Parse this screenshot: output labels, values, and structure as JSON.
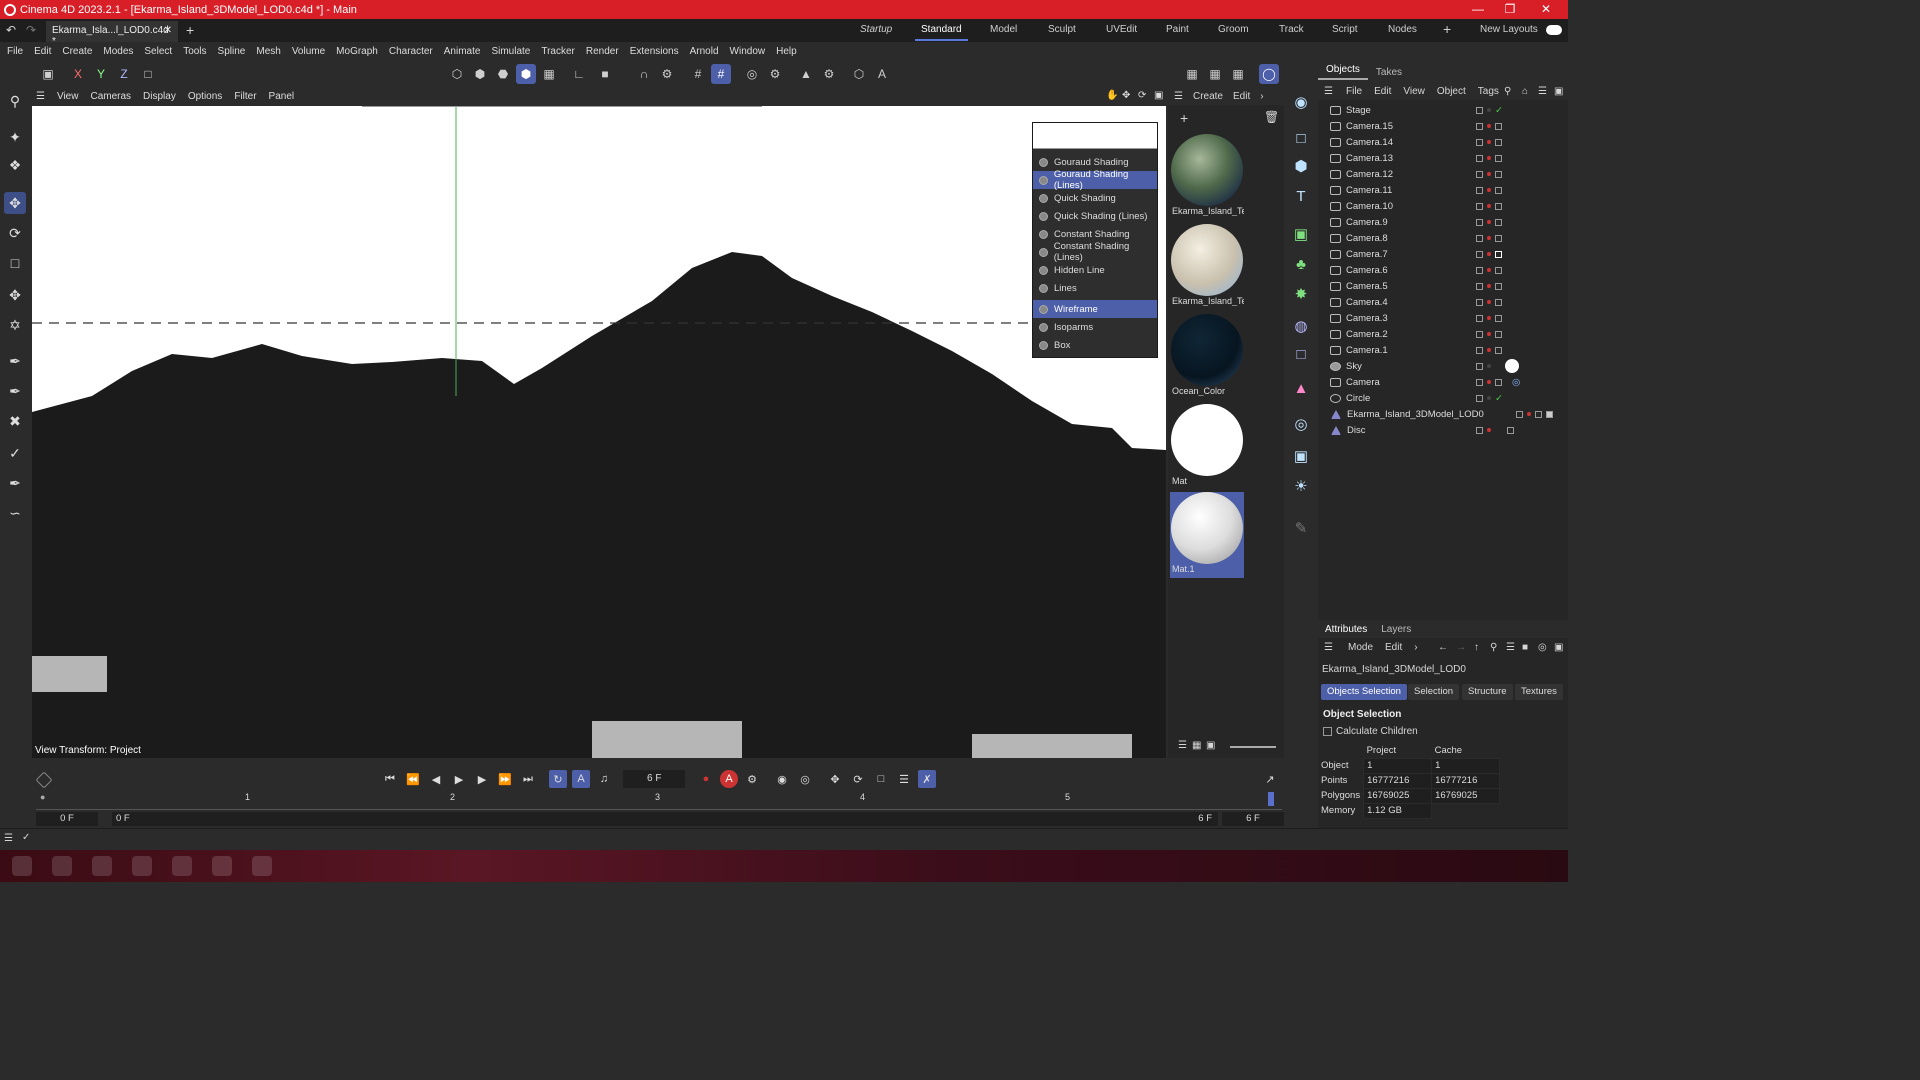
{
  "window": {
    "title": "Cinema 4D 2023.2.1 - [Ekarma_Island_3DModel_LOD0.c4d *] - Main"
  },
  "tabs": {
    "document": "Ekarma_Isla...l_LOD0.c4d *",
    "layouts": [
      "Startup",
      "Standard",
      "Model",
      "Sculpt",
      "UVEdit",
      "Paint",
      "Groom",
      "Track",
      "Script",
      "Nodes"
    ],
    "active_layout": "Standard",
    "new_layouts": "New Layouts"
  },
  "menu": [
    "File",
    "Edit",
    "Create",
    "Modes",
    "Select",
    "Tools",
    "Spline",
    "Mesh",
    "Volume",
    "MoGraph",
    "Character",
    "Animate",
    "Simulate",
    "Tracker",
    "Render",
    "Extensions",
    "Arnold",
    "Window",
    "Help"
  ],
  "axes": {
    "x": "X",
    "y": "Y",
    "z": "Z"
  },
  "viewport": {
    "menu": [
      "View",
      "Cameras",
      "Display",
      "Options",
      "Filter",
      "Panel"
    ],
    "view_transform": "View Transform: Project"
  },
  "shading_menu": {
    "items": [
      "Gouraud Shading",
      "Gouraud Shading (Lines)",
      "Quick Shading",
      "Quick Shading (Lines)",
      "Constant Shading",
      "Constant Shading (Lines)",
      "Hidden Line",
      "Lines",
      "Wireframe",
      "Isoparms",
      "Box"
    ],
    "selected": [
      "Gouraud Shading (Lines)",
      "Wireframe"
    ]
  },
  "materials": {
    "menu": [
      "Create",
      "Edit"
    ],
    "items": [
      "Ekarma_Island_Te",
      "Ekarma_Island_Te",
      "Ocean_Color",
      "Mat",
      "Mat.1"
    ]
  },
  "objects": {
    "tabs": [
      "Objects",
      "Takes"
    ],
    "menu": [
      "File",
      "Edit",
      "View",
      "Object",
      "Tags"
    ],
    "items": [
      "Stage",
      "Camera.15",
      "Camera.14",
      "Camera.13",
      "Camera.12",
      "Camera.11",
      "Camera.10",
      "Camera.9",
      "Camera.8",
      "Camera.7",
      "Camera.6",
      "Camera.5",
      "Camera.4",
      "Camera.3",
      "Camera.2",
      "Camera.1",
      "Sky",
      "Camera",
      "Circle",
      "Ekarma_Island_3DModel_LOD0",
      "Disc"
    ]
  },
  "attributes": {
    "tabs": [
      "Attributes",
      "Layers"
    ],
    "mode_menu": [
      "Mode",
      "Edit"
    ],
    "object_name": "Ekarma_Island_3DModel_LOD0",
    "subtabs": [
      "Objects Selection",
      "Selection",
      "Structure",
      "Textures"
    ],
    "section": "Object Selection",
    "calc_children": "Calculate Children",
    "col_project": "Project",
    "col_cache": "Cache",
    "rows": [
      {
        "label": "Object",
        "project": "1",
        "cache": "1"
      },
      {
        "label": "Points",
        "project": "16777216",
        "cache": "16777216"
      },
      {
        "label": "Polygons",
        "project": "16769025",
        "cache": "16769025"
      },
      {
        "label": "Memory",
        "project": "1.12 GB",
        "cache": ""
      }
    ]
  },
  "timeline": {
    "current_frame": "6 F",
    "ticks": [
      "1",
      "2",
      "3",
      "4",
      "5"
    ],
    "start": "0 F",
    "range_start": "0 F",
    "range_end": "6 F",
    "end": "6 F"
  },
  "colors": {
    "titlebar": "#d81f28",
    "accent": "#4c5fa8",
    "viewport_bg": "#ffffff",
    "terrain": "#1b1b1b"
  }
}
